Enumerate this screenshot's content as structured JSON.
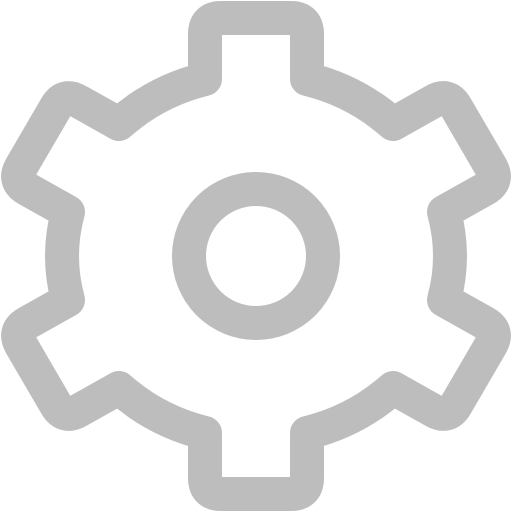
{
  "icon": {
    "name": "gear-icon",
    "stroke_color": "#bdbdbd",
    "fill_color": "#ffffff",
    "background": "#ffffff"
  }
}
